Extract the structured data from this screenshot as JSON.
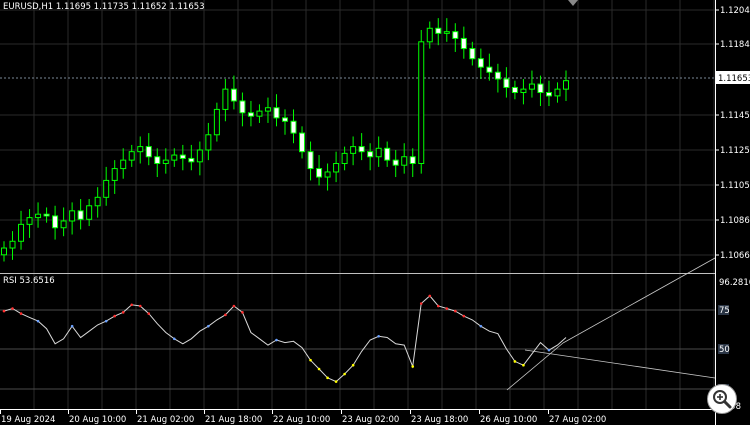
{
  "main_chart": {
    "symbol_header": "EURUSD,H1  1.11695 1.11735 1.11652 1.11653",
    "price_labels": [
      "1.12040",
      "1.11845",
      "1.11450",
      "1.11250",
      "1.11055",
      "1.10860",
      "1.10665"
    ],
    "current_price": "1.11653"
  },
  "rsi_panel": {
    "header": "RSI 53.6516",
    "scale_top": "96.2816",
    "level_labels": [
      "75",
      "50",
      "25"
    ],
    "scale_bottom": "-0.58"
  },
  "time_axis": [
    "19 Aug 2024",
    "20 Aug 10:00",
    "21 Aug 02:00",
    "21 Aug 18:00",
    "22 Aug 10:00",
    "23 Aug 02:00",
    "23 Aug 18:00",
    "26 Aug 10:00",
    "27 Aug 02:00"
  ],
  "colors": {
    "background": "#000000",
    "bull_body": "#000000",
    "bear_body": "#ffffff",
    "wick": "#00ff00",
    "grid": "#2a2a2a",
    "price_line": "#7a8796",
    "rsi_line": "#d8d8d8",
    "rsi_overbought_dot": "#ff3030",
    "rsi_oversold_dot": "#ffff00",
    "trend_line": "#c8c8c8"
  },
  "chart_data": {
    "type": "candlestick",
    "symbol": "EURUSD",
    "timeframe": "H1",
    "ohlc_header": {
      "open": 1.11695,
      "high": 1.11735,
      "low": 1.11652,
      "close": 1.11653
    },
    "y_range": [
      1.1055,
      1.121
    ],
    "close_path": [
      1.1068,
      1.1072,
      1.1082,
      1.1086,
      1.1088,
      1.1087,
      1.108,
      1.1084,
      1.109,
      1.1085,
      1.1093,
      1.1098,
      1.1108,
      1.1115,
      1.112,
      1.1125,
      1.1128,
      1.1122,
      1.1118,
      1.112,
      1.1123,
      1.1121,
      1.1119,
      1.1126,
      1.1135,
      1.115,
      1.1162,
      1.1155,
      1.1148,
      1.1146,
      1.1149,
      1.1151,
      1.1145,
      1.1143,
      1.1136,
      1.1125,
      1.1115,
      1.111,
      1.1113,
      1.1118,
      1.1124,
      1.1128,
      1.1125,
      1.1122,
      1.1127,
      1.112,
      1.1117,
      1.1122,
      1.1118,
      1.119,
      1.1198,
      1.1195,
      1.1196,
      1.1192,
      1.1186,
      1.118,
      1.1175,
      1.1172,
      1.1168,
      1.1163,
      1.116,
      1.1162,
      1.1165,
      1.116,
      1.1158,
      1.1162,
      1.1167
    ],
    "rsi": {
      "value": 53.6516,
      "range": [
        -0.58,
        96.2816
      ],
      "levels": [
        75,
        50,
        25
      ],
      "values": [
        74,
        76,
        72,
        69,
        66,
        60,
        48,
        52,
        62,
        53,
        58,
        63,
        66,
        70,
        73,
        79,
        78,
        72,
        64,
        57,
        52,
        48,
        52,
        58,
        62,
        67,
        71,
        78,
        73,
        57,
        52,
        47,
        51,
        49,
        50,
        45,
        35,
        28,
        21,
        18,
        24,
        31,
        42,
        51,
        54,
        53,
        48,
        47,
        30,
        80,
        86,
        78,
        76,
        74,
        70,
        67,
        62,
        58,
        56,
        44,
        34,
        31,
        40,
        49,
        43,
        47,
        53
      ]
    }
  }
}
